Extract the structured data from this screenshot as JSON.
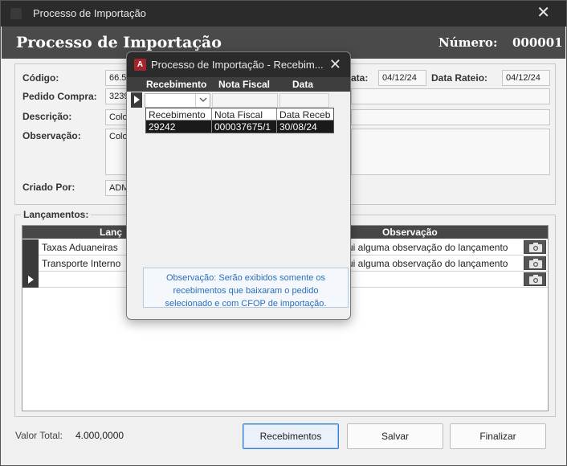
{
  "window": {
    "title": "Processo de Importação"
  },
  "header": {
    "title": "Processo de Importação",
    "numero_label": "Número:",
    "numero": "000001"
  },
  "form": {
    "codigo_label": "Código:",
    "codigo_value": "66.5",
    "data_label": "ata:",
    "data_value": "04/12/24",
    "data_rateio_label": "Data Rateio:",
    "data_rateio_value": "04/12/24",
    "pedido_label": "Pedido Compra:",
    "pedido_value": "3239",
    "descricao_label": "Descrição:",
    "descricao_value": "Colo",
    "observacao_label": "Observação:",
    "observacao_value": "Colo",
    "criado_label": "Criado Por:",
    "criado_value": "ADM"
  },
  "lancamentos": {
    "legend": "Lançamentos:",
    "col_lanc": "Lanç",
    "col_obs": "Observação",
    "rows": [
      {
        "lanc": "Taxas Aduaneiras",
        "obs": "ui alguma observação do lançamento"
      },
      {
        "lanc": "Transporte Interno",
        "obs": "ui alguma observação do lançamento"
      }
    ]
  },
  "footer": {
    "total_label": "Valor Total:",
    "total_value": "4.000,0000",
    "btn_recebimentos": "Recebimentos",
    "btn_salvar": "Salvar",
    "btn_finalizar": "Finalizar"
  },
  "popup": {
    "title": "Processo de Importação - Recebim...",
    "icon_letter": "A",
    "col_recebimento": "Recebimento",
    "col_nota": "Nota Fiscal",
    "col_data": "Data",
    "dropdown": {
      "head_recebimento": "Recebimento",
      "head_nota": "Nota Fiscal",
      "head_data": "Data Receb",
      "row_recebimento": "29242",
      "row_nota": "000037675/1",
      "row_data": "30/08/24"
    },
    "note": "Observação: Serão exibidos somente os recebimentos que baixaram o pedido selecionado e com CFOP de importação."
  }
}
